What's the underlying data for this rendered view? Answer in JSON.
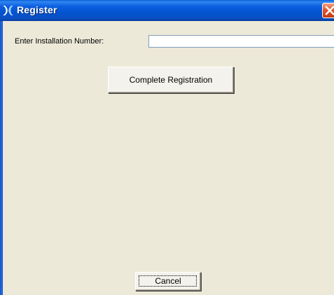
{
  "window": {
    "title": "Register",
    "title_icon": "app-logo-icon",
    "close_icon": "close-icon",
    "titlebar_color": "#0453d0",
    "body_color": "#ece9d8",
    "close_color": "#e2562c"
  },
  "form": {
    "installation_label": "Enter Installation Number:",
    "installation_value": "",
    "complete_button": "Complete Registration",
    "cancel_button": "Cancel"
  }
}
